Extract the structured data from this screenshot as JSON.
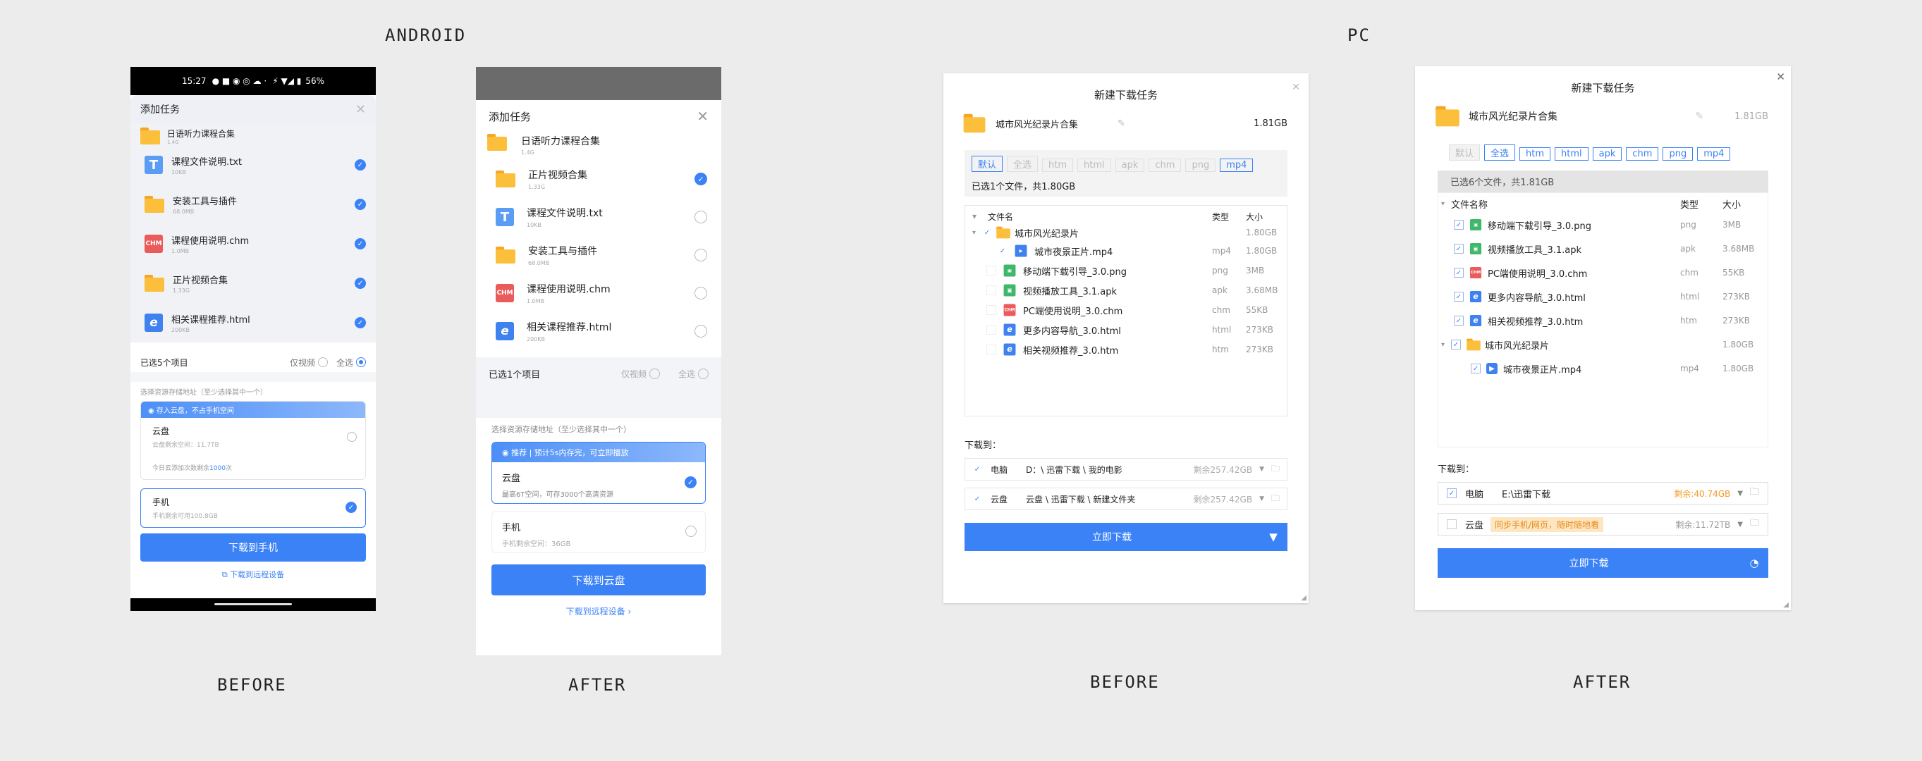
{
  "sections": {
    "android": "ANDROID",
    "pc": "PC"
  },
  "captions": {
    "ab": "BEFORE",
    "aa": "AFTER",
    "pb": "BEFORE",
    "pa": "AFTER"
  },
  "android_before": {
    "status_time": "15:27",
    "status_right": "56%",
    "title": "添加任务",
    "folder_name": "日语听力课程合集",
    "folder_size": "1.4G",
    "items": [
      {
        "name": "课程文件说明.txt",
        "size": "10KB",
        "icon": "txt"
      },
      {
        "name": "安装工具与插件",
        "size": "68.0MB",
        "icon": "folder"
      },
      {
        "name": "课程使用说明.chm",
        "size": "1.0MB",
        "icon": "chm"
      },
      {
        "name": "正片视频合集",
        "size": "1.33G",
        "icon": "folder"
      },
      {
        "name": "相关课程推荐.html",
        "size": "200KB",
        "icon": "ie"
      }
    ],
    "selected_count": "已选5个项目",
    "only_video": "仅视频",
    "select_all": "全选",
    "storage_hint": "选择资源存储地址（至少选择其中一个）",
    "cloud_banner": "存入云盘，不占手机空间",
    "cloud_title": "云盘",
    "cloud_space": "云盘剩余空间：11.7TB",
    "cloud_quota_prefix": "今日云添加次数剩余",
    "cloud_quota_num": "1000",
    "cloud_quota_suffix": "次",
    "phone_title": "手机",
    "phone_space": "手机剩余可用100.8GB",
    "download_btn": "下载到手机",
    "remote_link": "下载到远程设备"
  },
  "android_after": {
    "title": "添加任务",
    "folder_name": "日语听力课程合集",
    "folder_size": "1.4G",
    "items": [
      {
        "name": "正片视频合集",
        "size": "1.33G",
        "icon": "folder",
        "checked": true
      },
      {
        "name": "课程文件说明.txt",
        "size": "10KB",
        "icon": "txt",
        "checked": false
      },
      {
        "name": "安装工具与插件",
        "size": "68.0MB",
        "icon": "folder",
        "checked": false
      },
      {
        "name": "课程使用说明.chm",
        "size": "1.0MB",
        "icon": "chm",
        "checked": false
      },
      {
        "name": "相关课程推荐.html",
        "size": "200KB",
        "icon": "ie",
        "checked": false
      }
    ],
    "selected_count": "已选1个项目",
    "only_video": "仅视频",
    "select_all": "全选",
    "storage_hint": "选择资源存储地址（至少选择其中一个）",
    "cloud_banner": "推荐 | 预计5s内存完，可立即播放",
    "cloud_title": "云盘",
    "cloud_space": "最高6T空间，可存3000个高清资源",
    "phone_title": "手机",
    "phone_space": "手机剩余空间：36GB",
    "download_btn": "下载到云盘",
    "remote_link": "下载到远程设备"
  },
  "pc_before": {
    "title": "新建下载任务",
    "folder_name": "城市风光纪录片合集",
    "folder_size": "1.81GB",
    "tags": [
      {
        "label": "默认",
        "style": "blue"
      },
      {
        "label": "全选",
        "style": "dis"
      },
      {
        "label": "htm",
        "style": "dis"
      },
      {
        "label": "html",
        "style": "dis"
      },
      {
        "label": "apk",
        "style": "dis"
      },
      {
        "label": "chm",
        "style": "dis"
      },
      {
        "label": "png",
        "style": "dis"
      },
      {
        "label": "mp4",
        "style": "blue"
      }
    ],
    "selected": "已选1个文件，共1.80GB",
    "col_name": "文件名",
    "col_type": "类型",
    "col_size": "大小",
    "folder_row": {
      "name": "城市风光纪录片",
      "size": "1.80GB"
    },
    "rows": [
      {
        "name": "城市夜景正片.mp4",
        "type": "mp4",
        "size": "1.80GB",
        "icon": "mp4",
        "checked": true,
        "indent": 2
      },
      {
        "name": "移动端下载引导_3.0.png",
        "type": "png",
        "size": "3MB",
        "icon": "png",
        "checked": false,
        "indent": 1
      },
      {
        "name": "视频播放工具_3.1.apk",
        "type": "apk",
        "size": "3.68MB",
        "icon": "apk",
        "checked": false,
        "indent": 1
      },
      {
        "name": "PC端使用说明_3.0.chm",
        "type": "chm",
        "size": "55KB",
        "icon": "chm",
        "checked": false,
        "indent": 1
      },
      {
        "name": "更多内容导航_3.0.html",
        "type": "html",
        "size": "273KB",
        "icon": "ie",
        "checked": false,
        "indent": 1
      },
      {
        "name": "相关视频推荐_3.0.htm",
        "type": "htm",
        "size": "273KB",
        "icon": "ie",
        "checked": false,
        "indent": 1
      }
    ],
    "download_to": "下载到：",
    "dest": [
      {
        "label": "电脑",
        "path": "D：\\ 迅雷下载 \\ 我的电影",
        "free": "剩余257.42GB"
      },
      {
        "label": "云盘",
        "path": "云盘 \\ 迅雷下载 \\ 新建文件夹",
        "free": "剩余257.42GB"
      }
    ],
    "download_btn": "立即下载"
  },
  "pc_after": {
    "title": "新建下载任务",
    "folder_name": "城市风光纪录片合集",
    "folder_size": "1.81GB",
    "tags": [
      {
        "label": "默认",
        "style": "dis"
      },
      {
        "label": "全选",
        "style": "blue"
      },
      {
        "label": "htm",
        "style": "blue"
      },
      {
        "label": "html",
        "style": "blue"
      },
      {
        "label": "apk",
        "style": "blue"
      },
      {
        "label": "chm",
        "style": "blue"
      },
      {
        "label": "png",
        "style": "blue"
      },
      {
        "label": "mp4",
        "style": "blue"
      }
    ],
    "selected": "已选6个文件，共1.81GB",
    "col_name": "文件名称",
    "col_type": "类型",
    "col_size": "大小",
    "rows": [
      {
        "name": "移动端下载引导_3.0.png",
        "type": "png",
        "size": "3MB",
        "icon": "png"
      },
      {
        "name": "视频播放工具_3.1.apk",
        "type": "apk",
        "size": "3.68MB",
        "icon": "apk"
      },
      {
        "name": "PC端使用说明_3.0.chm",
        "type": "chm",
        "size": "55KB",
        "icon": "chm"
      },
      {
        "name": "更多内容导航_3.0.html",
        "type": "html",
        "size": "273KB",
        "icon": "ie"
      },
      {
        "name": "相关视频推荐_3.0.htm",
        "type": "htm",
        "size": "273KB",
        "icon": "ie"
      }
    ],
    "folder_row": {
      "name": "城市风光纪录片",
      "size": "1.80GB"
    },
    "sub_row": {
      "name": "城市夜景正片.mp4",
      "type": "mp4",
      "size": "1.80GB"
    },
    "download_to": "下载到：",
    "pc_label": "电脑",
    "pc_path": "E:\\迅雷下载",
    "pc_free": "剩余:40.74GB",
    "cloud_label": "云盘",
    "cloud_badge": "同步手机/网页，随时随地看",
    "cloud_free": "剩余:11.72TB",
    "download_btn": "立即下载"
  }
}
